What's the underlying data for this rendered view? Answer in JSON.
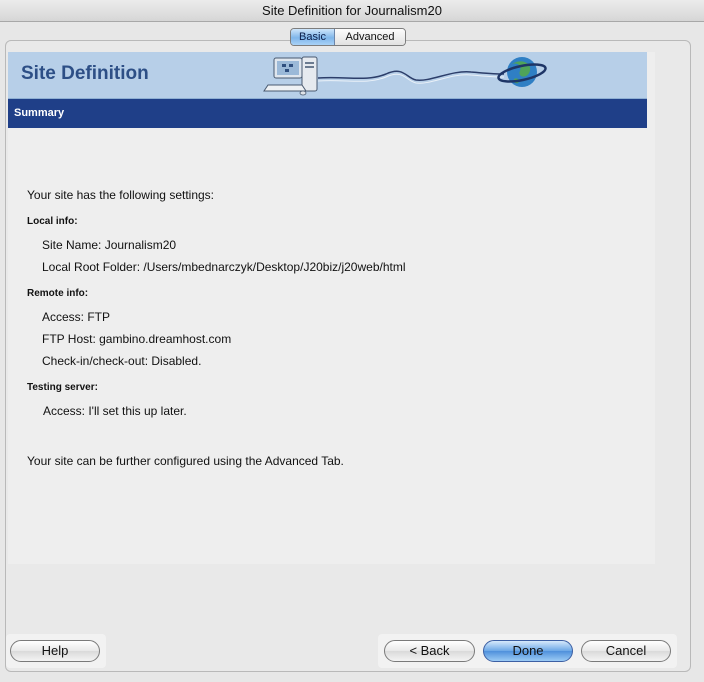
{
  "window": {
    "title": "Site Definition for Journalism20"
  },
  "tabs": [
    {
      "label": "Basic",
      "selected": true
    },
    {
      "label": "Advanced",
      "selected": false
    }
  ],
  "banner": {
    "title": "Site Definition",
    "icons": [
      "computer-icon",
      "globe-icon"
    ]
  },
  "section": {
    "title": "Summary"
  },
  "summary": {
    "intro": "Your site has the following settings:",
    "local_header": "Local info:",
    "site_name": "Site Name: Journalism20",
    "local_root": "Local Root Folder: /Users/mbednarczyk/Desktop/J20biz/j20web/html",
    "remote_header": "Remote info:",
    "access": "Access: FTP",
    "ftp_host": "FTP Host: gambino.dreamhost.com",
    "checkin": "Check-in/check-out: Disabled.",
    "testing_header": "Testing server:",
    "testing_access": "Access: I'll set this up later.",
    "footer": "Your site can be further configured using the Advanced Tab."
  },
  "buttons": {
    "help": "Help",
    "back": "< Back",
    "done": "Done",
    "cancel": "Cancel"
  },
  "colors": {
    "banner": "#b7cfe8",
    "section_bar": "#1f3f88",
    "banner_title": "#2d4f86",
    "tab_selected": "#7fb6ea",
    "default_button": "#4f90dc"
  }
}
